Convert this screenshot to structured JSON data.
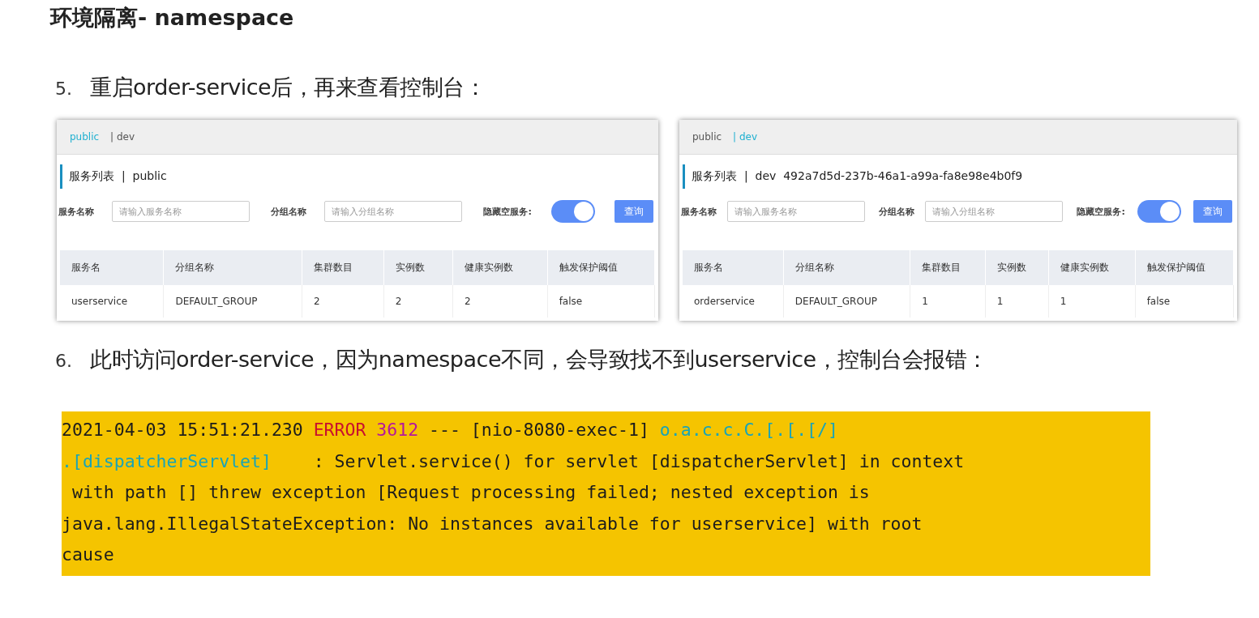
{
  "title": "环境隔离- namespace",
  "steps": [
    {
      "number": "5.",
      "text": "重启order-service后，再来查看控制台："
    },
    {
      "number": "6.",
      "text": "此时访问order-service，因为namespace不同，会导致找不到userservice，控制台会报错："
    }
  ],
  "consoles": [
    {
      "namespaces": [
        {
          "label": "public",
          "selected": true
        },
        {
          "label": "| dev",
          "selected": false
        }
      ],
      "heading": "服务列表  |  public",
      "filters": [
        {
          "label": "服务名称",
          "placeholder": "请输入服务名称"
        },
        {
          "label": "分组名称",
          "placeholder": "请输入分组名称"
        }
      ],
      "hide_empty": {
        "label": "隐藏空服务:",
        "on": true
      },
      "query_button": "查询",
      "columns": [
        "服务名",
        "分组名称",
        "集群数目",
        "实例数",
        "健康实例数",
        "触发保护阈值"
      ],
      "rows": [
        [
          "userservice",
          "DEFAULT_GROUP",
          "2",
          "2",
          "2",
          "false"
        ]
      ]
    },
    {
      "namespaces": [
        {
          "label": "public",
          "selected": false
        },
        {
          "label": "| dev",
          "selected": true
        }
      ],
      "heading": "服务列表  |  dev  492a7d5d-237b-46a1-a99a-fa8e98e4b0f9",
      "filters": [
        {
          "label": "服务名称",
          "placeholder": "请输入服务名称"
        },
        {
          "label": "分组名称",
          "placeholder": "请输入分组名称"
        }
      ],
      "hide_empty": {
        "label": "隐藏空服务:",
        "on": true
      },
      "query_button": "查询",
      "columns": [
        "服务名",
        "分组名称",
        "集群数目",
        "实例数",
        "健康实例数",
        "触发保护阈值"
      ],
      "rows": [
        [
          "orderservice",
          "DEFAULT_GROUP",
          "1",
          "1",
          "1",
          "false"
        ]
      ]
    }
  ],
  "log": [
    [
      {
        "kind": "plain",
        "text": "2021-04-03 15:51:21.230 "
      },
      {
        "kind": "error",
        "text": "ERROR"
      },
      {
        "kind": "pid",
        "text": " 3612"
      },
      {
        "kind": "plain",
        "text": " --- [nio-8080-exec-1] "
      },
      {
        "kind": "logger",
        "text": "o.a.c.c.C.[.[.[/]"
      }
    ],
    [
      {
        "kind": "logger",
        "text": ".[dispatcherServlet]"
      },
      {
        "kind": "plain",
        "text": "    : Servlet.service() for servlet [dispatcherServlet] in context"
      }
    ],
    [
      {
        "kind": "plain",
        "text": " with path [] threw exception [Request processing failed; nested exception is"
      }
    ],
    [
      {
        "kind": "plain",
        "text": "java.lang.IllegalStateException: No instances available for userservice] with root"
      }
    ],
    [
      {
        "kind": "plain",
        "text": "cause"
      }
    ]
  ]
}
